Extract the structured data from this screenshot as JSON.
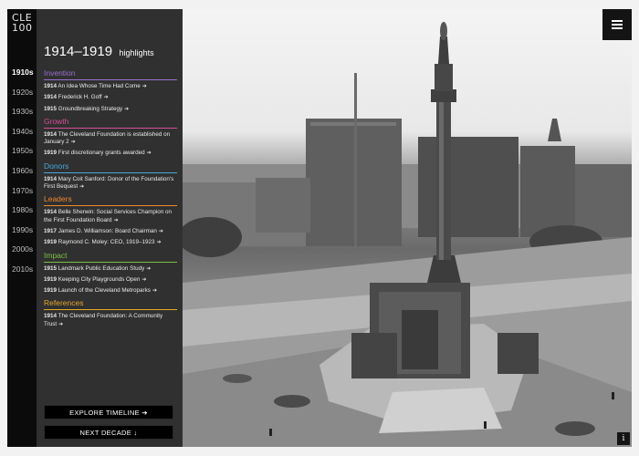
{
  "brand": {
    "logo_line1": "CLE",
    "logo_line2": "100"
  },
  "decades": [
    "1910s",
    "1920s",
    "1930s",
    "1940s",
    "1950s",
    "1960s",
    "1970s",
    "1980s",
    "1990s",
    "2000s",
    "2010s"
  ],
  "active_decade": "1910s",
  "panel": {
    "title_years": "1914–1919",
    "title_suffix": "highlights",
    "sections": [
      {
        "title": "Invention",
        "color": "#9b6fcf",
        "items": [
          {
            "year": "1914",
            "text": "An Idea Whose Time Had Come"
          },
          {
            "year": "1914",
            "text": "Frederick H. Goff"
          },
          {
            "year": "1915",
            "text": "Groundbreaking Strategy"
          }
        ]
      },
      {
        "title": "Growth",
        "color": "#d64d9a",
        "items": [
          {
            "year": "1914",
            "text": "The Cleveland Foundation is established on January 2"
          },
          {
            "year": "1919",
            "text": "First discretionary grants awarded"
          }
        ]
      },
      {
        "title": "Donors",
        "color": "#4aa8d8",
        "items": [
          {
            "year": "1914",
            "text": "Mary Coit Sanford: Donor of the Foundation's First Bequest"
          }
        ]
      },
      {
        "title": "Leaders",
        "color": "#f08a2c",
        "items": [
          {
            "year": "1914",
            "text": "Belle Sherwin: Social Services Champion on the First Foundation Board"
          },
          {
            "year": "1917",
            "text": "James D. Williamson: Board Chairman"
          },
          {
            "year": "1919",
            "text": "Raymond C. Moley: CEO, 1919–1923"
          }
        ]
      },
      {
        "title": "Impact",
        "color": "#79c142",
        "items": [
          {
            "year": "1915",
            "text": "Landmark Public Education Study"
          },
          {
            "year": "1919",
            "text": "Keeping City Playgrounds Open"
          },
          {
            "year": "1919",
            "text": "Launch of the Cleveland Metroparks"
          }
        ]
      },
      {
        "title": "References",
        "color": "#e5a72b",
        "items": [
          {
            "year": "1914",
            "text": "The Cleveland Foundation: A Community Trust"
          }
        ]
      }
    ],
    "explore_label": "EXPLORE TIMELINE",
    "next_label": "NEXT DECADE",
    "arrow_right": "➔",
    "arrow_down": "↓"
  },
  "info_label": "i"
}
